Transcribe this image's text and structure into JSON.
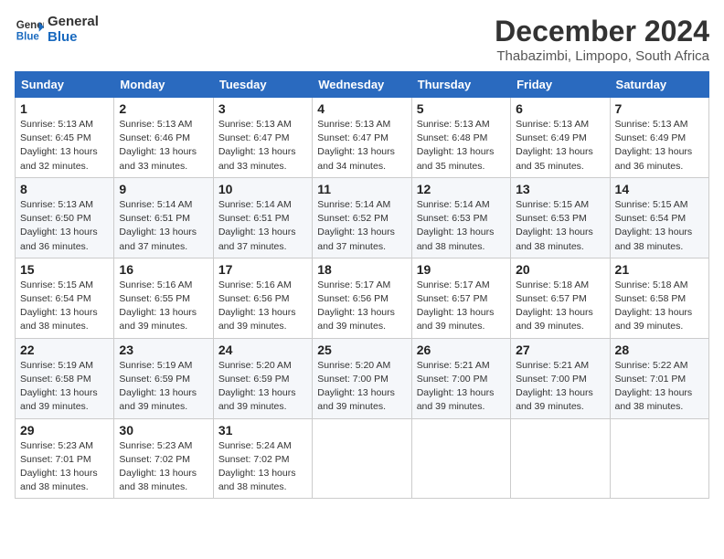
{
  "logo": {
    "line1": "General",
    "line2": "Blue"
  },
  "title": "December 2024",
  "location": "Thabazimbi, Limpopo, South Africa",
  "weekdays": [
    "Sunday",
    "Monday",
    "Tuesday",
    "Wednesday",
    "Thursday",
    "Friday",
    "Saturday"
  ],
  "weeks": [
    [
      {
        "day": "1",
        "info": "Sunrise: 5:13 AM\nSunset: 6:45 PM\nDaylight: 13 hours\nand 32 minutes."
      },
      {
        "day": "2",
        "info": "Sunrise: 5:13 AM\nSunset: 6:46 PM\nDaylight: 13 hours\nand 33 minutes."
      },
      {
        "day": "3",
        "info": "Sunrise: 5:13 AM\nSunset: 6:47 PM\nDaylight: 13 hours\nand 33 minutes."
      },
      {
        "day": "4",
        "info": "Sunrise: 5:13 AM\nSunset: 6:47 PM\nDaylight: 13 hours\nand 34 minutes."
      },
      {
        "day": "5",
        "info": "Sunrise: 5:13 AM\nSunset: 6:48 PM\nDaylight: 13 hours\nand 35 minutes."
      },
      {
        "day": "6",
        "info": "Sunrise: 5:13 AM\nSunset: 6:49 PM\nDaylight: 13 hours\nand 35 minutes."
      },
      {
        "day": "7",
        "info": "Sunrise: 5:13 AM\nSunset: 6:49 PM\nDaylight: 13 hours\nand 36 minutes."
      }
    ],
    [
      {
        "day": "8",
        "info": "Sunrise: 5:13 AM\nSunset: 6:50 PM\nDaylight: 13 hours\nand 36 minutes."
      },
      {
        "day": "9",
        "info": "Sunrise: 5:14 AM\nSunset: 6:51 PM\nDaylight: 13 hours\nand 37 minutes."
      },
      {
        "day": "10",
        "info": "Sunrise: 5:14 AM\nSunset: 6:51 PM\nDaylight: 13 hours\nand 37 minutes."
      },
      {
        "day": "11",
        "info": "Sunrise: 5:14 AM\nSunset: 6:52 PM\nDaylight: 13 hours\nand 37 minutes."
      },
      {
        "day": "12",
        "info": "Sunrise: 5:14 AM\nSunset: 6:53 PM\nDaylight: 13 hours\nand 38 minutes."
      },
      {
        "day": "13",
        "info": "Sunrise: 5:15 AM\nSunset: 6:53 PM\nDaylight: 13 hours\nand 38 minutes."
      },
      {
        "day": "14",
        "info": "Sunrise: 5:15 AM\nSunset: 6:54 PM\nDaylight: 13 hours\nand 38 minutes."
      }
    ],
    [
      {
        "day": "15",
        "info": "Sunrise: 5:15 AM\nSunset: 6:54 PM\nDaylight: 13 hours\nand 38 minutes."
      },
      {
        "day": "16",
        "info": "Sunrise: 5:16 AM\nSunset: 6:55 PM\nDaylight: 13 hours\nand 39 minutes."
      },
      {
        "day": "17",
        "info": "Sunrise: 5:16 AM\nSunset: 6:56 PM\nDaylight: 13 hours\nand 39 minutes."
      },
      {
        "day": "18",
        "info": "Sunrise: 5:17 AM\nSunset: 6:56 PM\nDaylight: 13 hours\nand 39 minutes."
      },
      {
        "day": "19",
        "info": "Sunrise: 5:17 AM\nSunset: 6:57 PM\nDaylight: 13 hours\nand 39 minutes."
      },
      {
        "day": "20",
        "info": "Sunrise: 5:18 AM\nSunset: 6:57 PM\nDaylight: 13 hours\nand 39 minutes."
      },
      {
        "day": "21",
        "info": "Sunrise: 5:18 AM\nSunset: 6:58 PM\nDaylight: 13 hours\nand 39 minutes."
      }
    ],
    [
      {
        "day": "22",
        "info": "Sunrise: 5:19 AM\nSunset: 6:58 PM\nDaylight: 13 hours\nand 39 minutes."
      },
      {
        "day": "23",
        "info": "Sunrise: 5:19 AM\nSunset: 6:59 PM\nDaylight: 13 hours\nand 39 minutes."
      },
      {
        "day": "24",
        "info": "Sunrise: 5:20 AM\nSunset: 6:59 PM\nDaylight: 13 hours\nand 39 minutes."
      },
      {
        "day": "25",
        "info": "Sunrise: 5:20 AM\nSunset: 7:00 PM\nDaylight: 13 hours\nand 39 minutes."
      },
      {
        "day": "26",
        "info": "Sunrise: 5:21 AM\nSunset: 7:00 PM\nDaylight: 13 hours\nand 39 minutes."
      },
      {
        "day": "27",
        "info": "Sunrise: 5:21 AM\nSunset: 7:00 PM\nDaylight: 13 hours\nand 39 minutes."
      },
      {
        "day": "28",
        "info": "Sunrise: 5:22 AM\nSunset: 7:01 PM\nDaylight: 13 hours\nand 38 minutes."
      }
    ],
    [
      {
        "day": "29",
        "info": "Sunrise: 5:23 AM\nSunset: 7:01 PM\nDaylight: 13 hours\nand 38 minutes."
      },
      {
        "day": "30",
        "info": "Sunrise: 5:23 AM\nSunset: 7:02 PM\nDaylight: 13 hours\nand 38 minutes."
      },
      {
        "day": "31",
        "info": "Sunrise: 5:24 AM\nSunset: 7:02 PM\nDaylight: 13 hours\nand 38 minutes."
      },
      {
        "day": "",
        "info": ""
      },
      {
        "day": "",
        "info": ""
      },
      {
        "day": "",
        "info": ""
      },
      {
        "day": "",
        "info": ""
      }
    ]
  ]
}
